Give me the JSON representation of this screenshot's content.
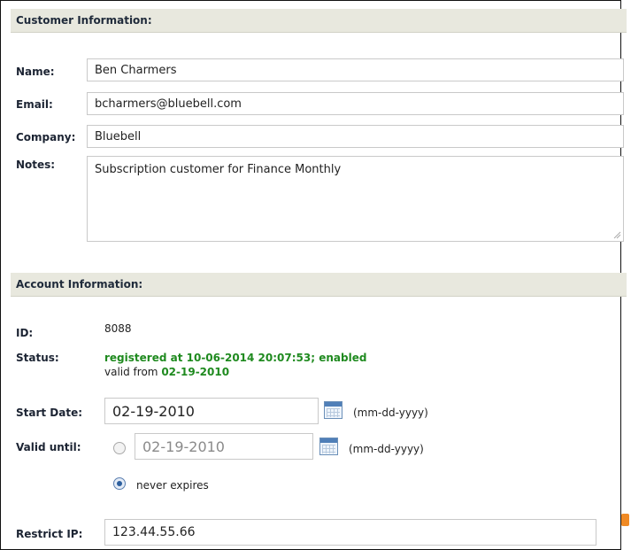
{
  "customer": {
    "section_title": "Customer Information:",
    "name_label": "Name:",
    "name_value": "Ben Charmers",
    "email_label": "Email:",
    "email_value": "bcharmers@bluebell.com",
    "company_label": "Company:",
    "company_value": "Bluebell",
    "notes_label": "Notes:",
    "notes_value": "Subscription customer for Finance Monthly"
  },
  "account": {
    "section_title": "Account Information:",
    "id_label": "ID:",
    "id_value": "8088",
    "status_label": "Status:",
    "status_line1": "registered at 10-06-2014 20:07:53; enabled",
    "status_valid_prefix": "valid from",
    "status_valid_date": "02-19-2010",
    "start_label": "Start Date:",
    "start_value": "02-19-2010",
    "date_format_hint": "(mm-dd-yyyy)",
    "valid_until_label": "Valid until:",
    "valid_until_value": "02-19-2010",
    "valid_until_selected": false,
    "never_expires_label": "never expires",
    "never_expires_selected": true,
    "restrict_ip_label": "Restrict IP:",
    "restrict_ip_value": "123.44.55.66"
  },
  "icons": {
    "calendar": "calendar-icon",
    "rss": "rss-icon"
  },
  "colors": {
    "section_bar": "#e8e8de",
    "status_green": "#1f8a1f",
    "rss_orange": "#f08a24"
  }
}
